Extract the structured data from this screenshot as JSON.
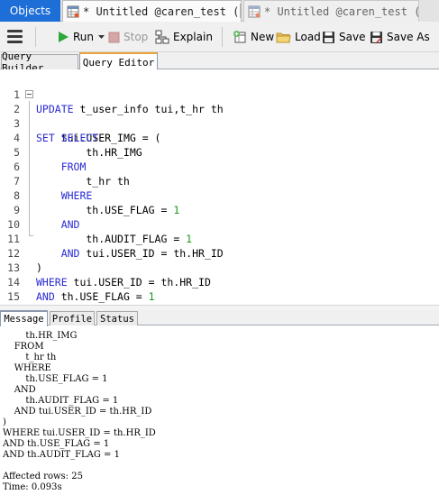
{
  "doc_tabs": {
    "objects_label": "Objects",
    "active_tab_label": "* Untitled @caren_test (C...",
    "inactive_tab_label": "* Untitled @caren_test (C..."
  },
  "toolbar": {
    "run_label": "Run",
    "stop_label": "Stop",
    "explain_label": "Explain",
    "new_label": "New",
    "load_label": "Load",
    "save_label": "Save",
    "save_as_label": "Save As"
  },
  "sub_tabs": {
    "builder_label": "Query Builder",
    "editor_label": "Query Editor"
  },
  "editor": {
    "lines": [
      {
        "num": "1",
        "text": "UPDATE t_user_info tui,t_hr th"
      },
      {
        "num": "2",
        "text": "SET tui.USER_IMG = ("
      },
      {
        "num": "3",
        "text": "    SELECT"
      },
      {
        "num": "4",
        "text": "        th.HR_IMG"
      },
      {
        "num": "5",
        "text": "    FROM"
      },
      {
        "num": "6",
        "text": "        t_hr th"
      },
      {
        "num": "7",
        "text": "    WHERE"
      },
      {
        "num": "8",
        "text": "        th.USE_FLAG = 1"
      },
      {
        "num": "9",
        "text": "    AND"
      },
      {
        "num": "10",
        "text": "        th.AUDIT_FLAG = 1"
      },
      {
        "num": "11",
        "text": "    AND tui.USER_ID = th.HR_ID"
      },
      {
        "num": "12",
        "text": ")"
      },
      {
        "num": "13",
        "text": "WHERE tui.USER_ID = th.HR_ID"
      },
      {
        "num": "14",
        "text": "AND th.USE_FLAG = 1"
      },
      {
        "num": "15",
        "text": "AND th.AUDIT_FLAG = 1"
      }
    ]
  },
  "result_tabs": {
    "message_label": "Message",
    "profile_label": "Profile",
    "status_label": "Status"
  },
  "message": {
    "lines": [
      "        th.HR_IMG",
      "    FROM",
      "        t_hr th",
      "    WHERE",
      "        th.USE_FLAG = 1",
      "    AND",
      "        th.AUDIT_FLAG = 1",
      "    AND tui.USER_ID = th.HR_ID",
      ")",
      "WHERE tui.USER_ID = th.HR_ID",
      "AND th.USE_FLAG = 1",
      "AND th.AUDIT_FLAG = 1",
      "",
      "Affected rows: 25",
      "Time: 0.093s"
    ]
  },
  "colors": {
    "objects_tab_bg": "#1e6ed8",
    "keyword": "#2a2ad4",
    "number": "#1a9a1a",
    "active_tab_accent": "#e8a23a"
  },
  "icons": {
    "menu": "hamburger-icon",
    "run": "play-icon",
    "stop": "stop-icon",
    "explain": "explain-icon",
    "new": "new-query-icon",
    "load": "folder-icon",
    "save": "floppy-disk-icon",
    "save_as": "floppy-disk-edit-icon"
  }
}
